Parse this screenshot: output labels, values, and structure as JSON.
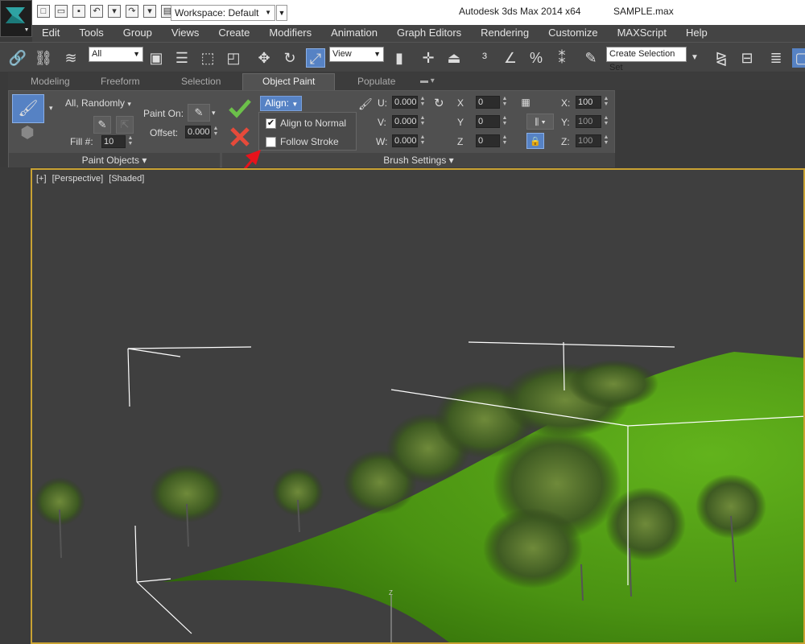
{
  "titlebar": {
    "workspace_label": "Workspace: Default",
    "app_title": "Autodesk 3ds Max  2014 x64",
    "file_name": "SAMPLE.max"
  },
  "menu": [
    "Edit",
    "Tools",
    "Group",
    "Views",
    "Create",
    "Modifiers",
    "Animation",
    "Graph Editors",
    "Rendering",
    "Customize",
    "MAXScript",
    "Help"
  ],
  "toolbar": {
    "selection_filter": "All",
    "reference_coord": "View",
    "named_selection_placeholder": "Create Selection Set"
  },
  "ribbon": {
    "tabs": [
      "Modeling",
      "Freeform",
      "Selection",
      "Object Paint",
      "Populate"
    ],
    "active_tab": "Object Paint",
    "paint_objects": {
      "mode": "All, Randomly",
      "fill_label": "Fill #:",
      "fill_value": "10",
      "footer": "Paint Objects"
    },
    "paint_on_label": "Paint On:",
    "offset_label": "Offset:",
    "offset_value": "0.000",
    "align": {
      "button_label": "Align:",
      "align_to_normal": "Align to Normal",
      "follow_stroke": "Follow Stroke"
    },
    "brush": {
      "u_label": "U:",
      "u_value": "0.000",
      "v_label": "V:",
      "v_value": "0.000",
      "w_label": "W:",
      "w_value": "0.000",
      "rx_label": "X",
      "rx_value": "0",
      "ry_label": "Y",
      "ry_value": "0",
      "rz_label": "Z",
      "rz_value": "0",
      "sx_label": "X:",
      "sx_value": "100",
      "sy_label": "Y:",
      "sy_value": "100",
      "sz_label": "Z:",
      "sz_value": "100",
      "footer": "Brush Settings"
    }
  },
  "viewport": {
    "label_plus": "[+]",
    "label_view": "[Perspective]",
    "label_shading": "[Shaded]",
    "axis_z": "Z"
  },
  "colors": {
    "accent": "#5682c4",
    "viewport_border": "#c9a233",
    "ground_green": "#4e9a10",
    "annotation_arrow": "#e8121b"
  }
}
